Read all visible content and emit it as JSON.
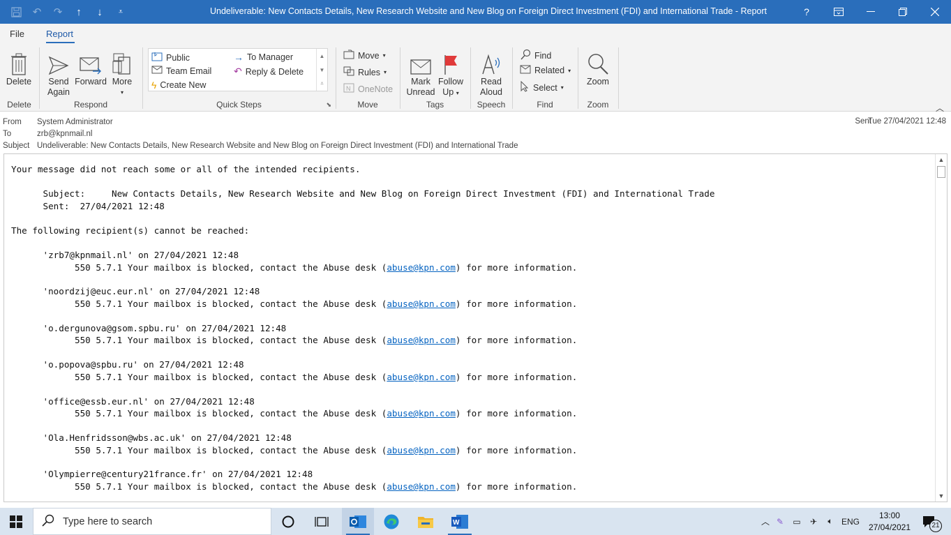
{
  "window": {
    "title": "Undeliverable: New Contacts Details, New Research Website and New Blog on Foreign Direct Investment (FDI) and International Trade  -  Report"
  },
  "colors": {
    "accent": "#2a6ebb",
    "link": "#0563c1",
    "taskbar": "#d9e4f0"
  },
  "tabs": [
    {
      "label": "File"
    },
    {
      "label": "Report"
    }
  ],
  "ribbon": {
    "delete": {
      "label": "Delete",
      "group": "Delete"
    },
    "respond": {
      "send_again_1": "Send",
      "send_again_2": "Again",
      "forward": "Forward",
      "more": "More",
      "group": "Respond"
    },
    "quick_steps": {
      "public": "Public",
      "to_manager": "To Manager",
      "team_email": "Team Email",
      "reply_delete": "Reply & Delete",
      "create_new": "Create New",
      "group": "Quick Steps"
    },
    "move": {
      "move": "Move",
      "rules": "Rules",
      "onenote": "OneNote",
      "group": "Move"
    },
    "tags": {
      "mark_unread_1": "Mark",
      "mark_unread_2": "Unread",
      "follow_up_1": "Follow",
      "follow_up_2": "Up",
      "group": "Tags"
    },
    "speech": {
      "read_aloud_1": "Read",
      "read_aloud_2": "Aloud",
      "group": "Speech"
    },
    "find": {
      "find": "Find",
      "related": "Related",
      "select": "Select",
      "group": "Find"
    },
    "zoom": {
      "zoom": "Zoom",
      "group": "Zoom"
    }
  },
  "header": {
    "from_label": "From",
    "from": "System Administrator",
    "to_label": "To",
    "to": "zrb@kpnmail.nl",
    "subject_label": "Subject",
    "subject": "Undeliverable: New Contacts Details, New Research Website and New Blog on Foreign Direct Investment (FDI) and International Trade",
    "sent_label": "Sent",
    "sent": "Tue 27/04/2021 12:48"
  },
  "body": {
    "intro": "Your message did not reach some or all of the intended recipients.",
    "subject_line": "      Subject:     New Contacts Details, New Research Website and New Blog on Foreign Direct Investment (FDI) and International Trade",
    "sent_line": "      Sent:  27/04/2021 12:48",
    "following": "The following recipient(s) cannot be reached:",
    "error_prefix": "            550 5.7.1 Your mailbox is blocked, contact the Abuse desk (",
    "error_link": "abuse@kpn.com",
    "error_suffix": ") for more information.",
    "recipients": [
      "      'zrb7@kpnmail.nl' on 27/04/2021 12:48",
      "      'noordzij@euc.eur.nl' on 27/04/2021 12:48",
      "      'o.dergunova@gsom.spbu.ru' on 27/04/2021 12:48",
      "      'o.popova@spbu.ru' on 27/04/2021 12:48",
      "      'office@essb.eur.nl' on 27/04/2021 12:48",
      "      'Ola.Henfridsson@wbs.ac.uk' on 27/04/2021 12:48",
      "      'Olympierre@century21france.fr' on 27/04/2021 12:48"
    ]
  },
  "taskbar": {
    "search_placeholder": "Type here to search",
    "language": "ENG",
    "time": "13:00",
    "date": "27/04/2021",
    "notifications": "21"
  }
}
